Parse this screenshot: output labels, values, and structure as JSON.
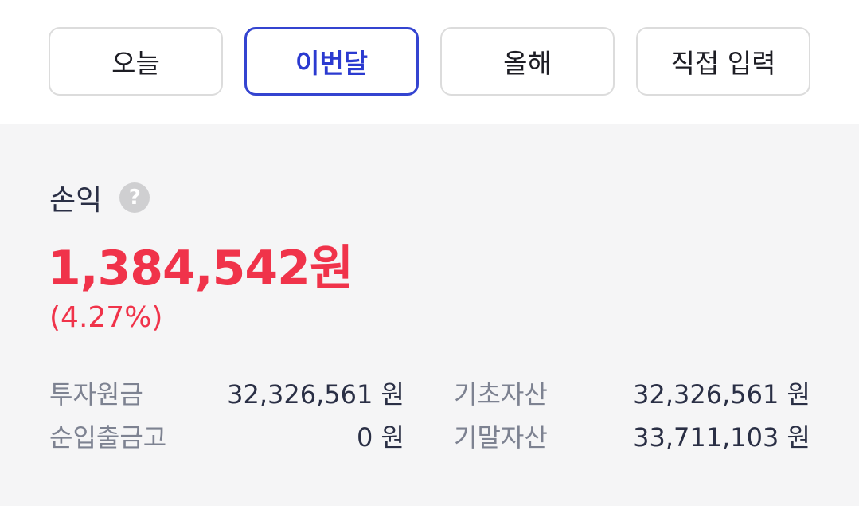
{
  "period_tabs": [
    {
      "label": "오늘",
      "active": false
    },
    {
      "label": "이번달",
      "active": true
    },
    {
      "label": "올해",
      "active": false
    },
    {
      "label": "직접 입력",
      "active": false
    }
  ],
  "summary": {
    "title": "손익",
    "help_icon": "?",
    "profit": "1,384,542원",
    "rate": "(4.27%)"
  },
  "details": {
    "principal_label": "투자원금",
    "principal_value": "32,326,561 원",
    "net_deposit_label": "순입출금고",
    "net_deposit_value": "0 원",
    "begin_asset_label": "기초자산",
    "begin_asset_value": "32,326,561 원",
    "end_asset_label": "기말자산",
    "end_asset_value": "33,711,103 원"
  },
  "colors": {
    "accent": "#3444d0",
    "profit": "#f0334a",
    "panel_bg": "#f5f5f6"
  }
}
